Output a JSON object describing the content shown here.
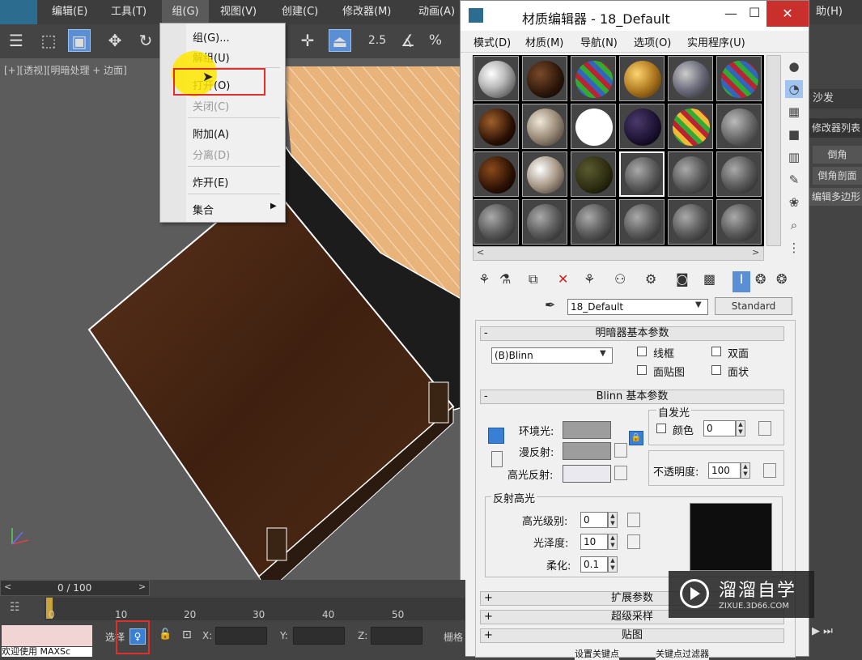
{
  "menubar": {
    "items": [
      "编辑(E)",
      "工具(T)",
      "组(G)",
      "视图(V)",
      "创建(C)",
      "修改器(M)",
      "动画(A)"
    ],
    "right_item": "助(H)"
  },
  "toolbar": {
    "snap_value": "2.5",
    "percent_label": "%"
  },
  "viewport": {
    "label": "[+][透视][明暗处理 + 边面]"
  },
  "group_menu": {
    "items": [
      {
        "label": "组(G)...",
        "enabled": true
      },
      {
        "label": "解组(U)",
        "enabled": true
      },
      {
        "label": "打开(O)",
        "enabled": true,
        "highlighted": true
      },
      {
        "label": "关闭(C)",
        "enabled": false
      },
      {
        "label": "附加(A)",
        "enabled": true
      },
      {
        "label": "分离(D)",
        "enabled": false
      },
      {
        "label": "炸开(E)",
        "enabled": true
      },
      {
        "label": "集合",
        "enabled": true,
        "submenu": true
      }
    ]
  },
  "material_editor": {
    "title": "材质编辑器 - 18_Default",
    "menu": [
      "模式(D)",
      "材质(M)",
      "导航(N)",
      "选项(O)",
      "实用程序(U)"
    ],
    "material_name": "18_Default",
    "material_type": "Standard",
    "rollouts": {
      "shader_basic": "明暗器基本参数",
      "blinn_basic": "Blinn 基本参数",
      "extended": "扩展参数",
      "supersampling": "超级采样",
      "maps": "贴图"
    },
    "shader": {
      "type": "(B)Blinn",
      "wire": "线框",
      "two_sided": "双面",
      "face_map": "面贴图",
      "faceted": "面状"
    },
    "blinn": {
      "ambient": "环境光:",
      "diffuse": "漫反射:",
      "specular": "高光反射:",
      "self_illum_group": "自发光",
      "color_label": "颜色",
      "color_value": "0",
      "opacity_label": "不透明度:",
      "opacity_value": "100"
    },
    "highlights": {
      "group": "反射高光",
      "level_label": "高光级别:",
      "level_value": "0",
      "gloss_label": "光泽度:",
      "gloss_value": "10",
      "soften_label": "柔化:",
      "soften_value": "0.1"
    }
  },
  "right_panel": {
    "object_name": "沙发",
    "modifier_list": "修改器列表",
    "buttons": [
      "倒角",
      "倒角剖面",
      "编辑多边形"
    ]
  },
  "timeline": {
    "frame_counter": "0 / 100",
    "ticks": [
      "0",
      "10",
      "20",
      "30",
      "40",
      "50"
    ],
    "status_text": "欢迎使用 MAXSc",
    "select_label": "选择",
    "x_label": "X:",
    "y_label": "Y:",
    "z_label": "Z:",
    "grid_label": "栅格",
    "set_key": "设置关键点",
    "key_filter": "关键点过滤器"
  },
  "watermark": {
    "brand": "溜溜自学",
    "url": "ZIXUE.3D66.COM"
  },
  "colors": {
    "accent_blue": "#5a8fd6",
    "highlight_red": "#e0302a",
    "wood_dark": "#4a2a14",
    "wood_light": "#e8b27a"
  }
}
